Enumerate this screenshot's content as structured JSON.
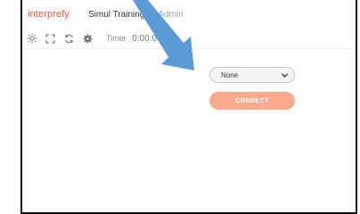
{
  "app": {
    "brand": "interprefy"
  },
  "session": {
    "title": "Simul Training",
    "subtitle": "— Admin"
  },
  "toolbar": {
    "icons": [
      "sun-icon",
      "fullscreen-icon",
      "refresh-icon",
      "gear-icon"
    ],
    "timer_label": "Timer",
    "timer_value": "0:00:00"
  },
  "main": {
    "channel_select": {
      "value": "None"
    },
    "connect_label": "CONNECT"
  },
  "colors": {
    "brand": "#ef5a3c",
    "connect_button": "#f9a98d",
    "annotation_arrow": "#5b9bd5"
  }
}
